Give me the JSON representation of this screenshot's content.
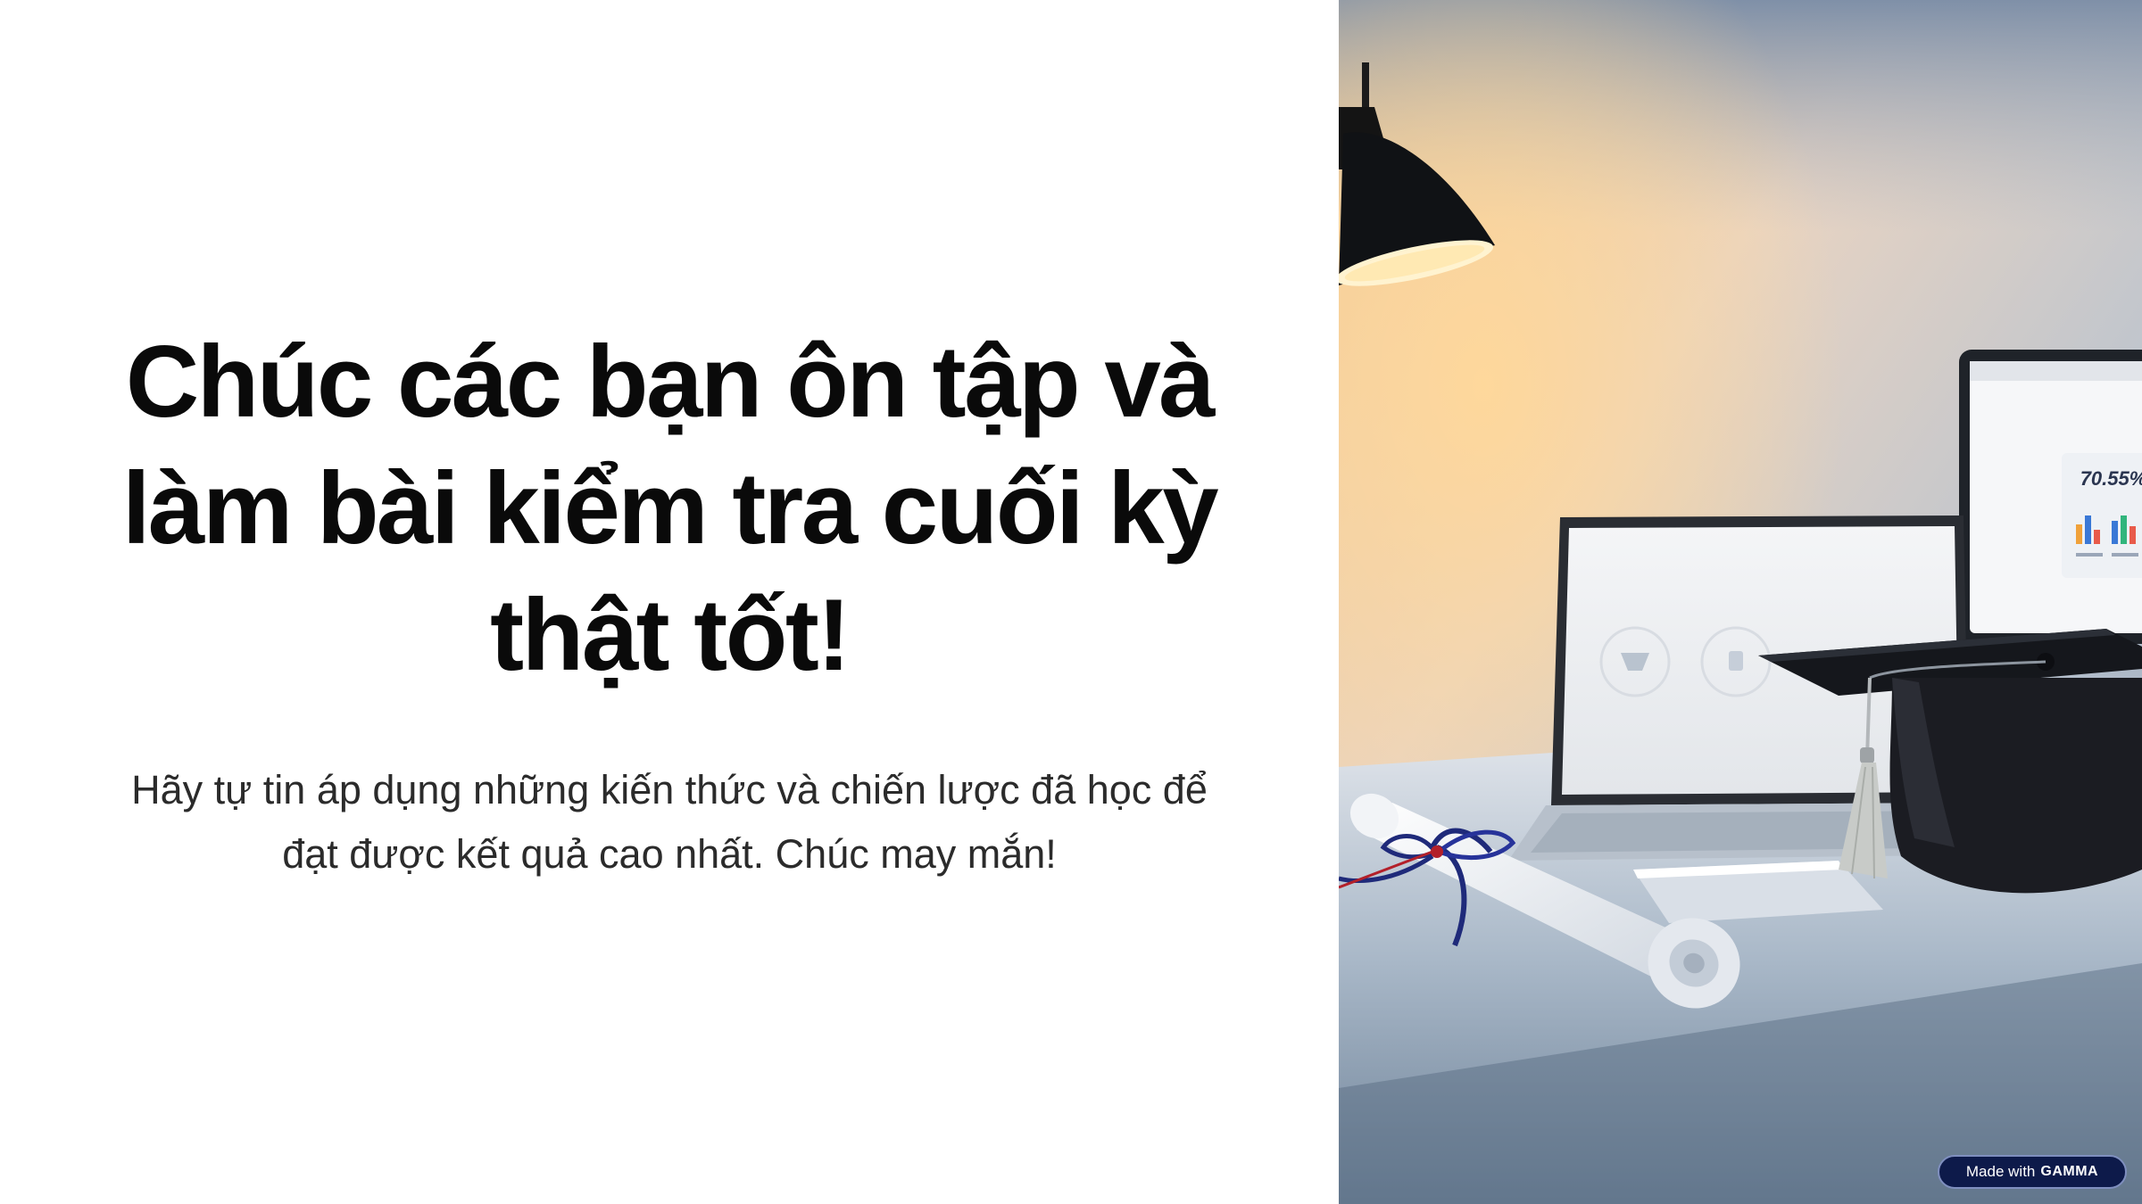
{
  "slide": {
    "title": "Chúc các bạn ôn tập và làm bài kiểm tra cuối kỳ thật tốt!",
    "subtitle": "Hãy tự tin áp dụng những kiến thức và chiến lược đã học để đạt được kết quả cao nhất. Chúc may mắn!"
  },
  "photo": {
    "monitor_stat": "70.55%",
    "icon": "graduation-desk-photo"
  },
  "badge": {
    "prefix": "Made with",
    "brand": "GAMMA"
  },
  "colors": {
    "title": "#0a0a0a",
    "subtitle": "#2b2b2b",
    "badge_bg": "#0d1a4a",
    "badge_border": "#7f8fbf"
  }
}
